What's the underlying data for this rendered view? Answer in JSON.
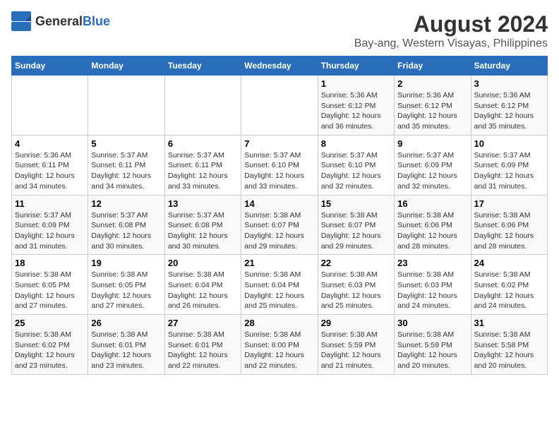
{
  "logo": {
    "general": "General",
    "blue": "Blue"
  },
  "title": "August 2024",
  "subtitle": "Bay-ang, Western Visayas, Philippines",
  "days_of_week": [
    "Sunday",
    "Monday",
    "Tuesday",
    "Wednesday",
    "Thursday",
    "Friday",
    "Saturday"
  ],
  "weeks": [
    [
      {
        "day": "",
        "info": ""
      },
      {
        "day": "",
        "info": ""
      },
      {
        "day": "",
        "info": ""
      },
      {
        "day": "",
        "info": ""
      },
      {
        "day": "1",
        "info": "Sunrise: 5:36 AM\nSunset: 6:12 PM\nDaylight: 12 hours\nand 36 minutes."
      },
      {
        "day": "2",
        "info": "Sunrise: 5:36 AM\nSunset: 6:12 PM\nDaylight: 12 hours\nand 35 minutes."
      },
      {
        "day": "3",
        "info": "Sunrise: 5:36 AM\nSunset: 6:12 PM\nDaylight: 12 hours\nand 35 minutes."
      }
    ],
    [
      {
        "day": "4",
        "info": "Sunrise: 5:36 AM\nSunset: 6:11 PM\nDaylight: 12 hours\nand 34 minutes."
      },
      {
        "day": "5",
        "info": "Sunrise: 5:37 AM\nSunset: 6:11 PM\nDaylight: 12 hours\nand 34 minutes."
      },
      {
        "day": "6",
        "info": "Sunrise: 5:37 AM\nSunset: 6:11 PM\nDaylight: 12 hours\nand 33 minutes."
      },
      {
        "day": "7",
        "info": "Sunrise: 5:37 AM\nSunset: 6:10 PM\nDaylight: 12 hours\nand 33 minutes."
      },
      {
        "day": "8",
        "info": "Sunrise: 5:37 AM\nSunset: 6:10 PM\nDaylight: 12 hours\nand 32 minutes."
      },
      {
        "day": "9",
        "info": "Sunrise: 5:37 AM\nSunset: 6:09 PM\nDaylight: 12 hours\nand 32 minutes."
      },
      {
        "day": "10",
        "info": "Sunrise: 5:37 AM\nSunset: 6:09 PM\nDaylight: 12 hours\nand 31 minutes."
      }
    ],
    [
      {
        "day": "11",
        "info": "Sunrise: 5:37 AM\nSunset: 6:09 PM\nDaylight: 12 hours\nand 31 minutes."
      },
      {
        "day": "12",
        "info": "Sunrise: 5:37 AM\nSunset: 6:08 PM\nDaylight: 12 hours\nand 30 minutes."
      },
      {
        "day": "13",
        "info": "Sunrise: 5:37 AM\nSunset: 6:08 PM\nDaylight: 12 hours\nand 30 minutes."
      },
      {
        "day": "14",
        "info": "Sunrise: 5:38 AM\nSunset: 6:07 PM\nDaylight: 12 hours\nand 29 minutes."
      },
      {
        "day": "15",
        "info": "Sunrise: 5:38 AM\nSunset: 6:07 PM\nDaylight: 12 hours\nand 29 minutes."
      },
      {
        "day": "16",
        "info": "Sunrise: 5:38 AM\nSunset: 6:06 PM\nDaylight: 12 hours\nand 28 minutes."
      },
      {
        "day": "17",
        "info": "Sunrise: 5:38 AM\nSunset: 6:06 PM\nDaylight: 12 hours\nand 28 minutes."
      }
    ],
    [
      {
        "day": "18",
        "info": "Sunrise: 5:38 AM\nSunset: 6:05 PM\nDaylight: 12 hours\nand 27 minutes."
      },
      {
        "day": "19",
        "info": "Sunrise: 5:38 AM\nSunset: 6:05 PM\nDaylight: 12 hours\nand 27 minutes."
      },
      {
        "day": "20",
        "info": "Sunrise: 5:38 AM\nSunset: 6:04 PM\nDaylight: 12 hours\nand 26 minutes."
      },
      {
        "day": "21",
        "info": "Sunrise: 5:38 AM\nSunset: 6:04 PM\nDaylight: 12 hours\nand 25 minutes."
      },
      {
        "day": "22",
        "info": "Sunrise: 5:38 AM\nSunset: 6:03 PM\nDaylight: 12 hours\nand 25 minutes."
      },
      {
        "day": "23",
        "info": "Sunrise: 5:38 AM\nSunset: 6:03 PM\nDaylight: 12 hours\nand 24 minutes."
      },
      {
        "day": "24",
        "info": "Sunrise: 5:38 AM\nSunset: 6:02 PM\nDaylight: 12 hours\nand 24 minutes."
      }
    ],
    [
      {
        "day": "25",
        "info": "Sunrise: 5:38 AM\nSunset: 6:02 PM\nDaylight: 12 hours\nand 23 minutes."
      },
      {
        "day": "26",
        "info": "Sunrise: 5:38 AM\nSunset: 6:01 PM\nDaylight: 12 hours\nand 23 minutes."
      },
      {
        "day": "27",
        "info": "Sunrise: 5:38 AM\nSunset: 6:01 PM\nDaylight: 12 hours\nand 22 minutes."
      },
      {
        "day": "28",
        "info": "Sunrise: 5:38 AM\nSunset: 6:00 PM\nDaylight: 12 hours\nand 22 minutes."
      },
      {
        "day": "29",
        "info": "Sunrise: 5:38 AM\nSunset: 5:59 PM\nDaylight: 12 hours\nand 21 minutes."
      },
      {
        "day": "30",
        "info": "Sunrise: 5:38 AM\nSunset: 5:59 PM\nDaylight: 12 hours\nand 20 minutes."
      },
      {
        "day": "31",
        "info": "Sunrise: 5:38 AM\nSunset: 5:58 PM\nDaylight: 12 hours\nand 20 minutes."
      }
    ]
  ]
}
